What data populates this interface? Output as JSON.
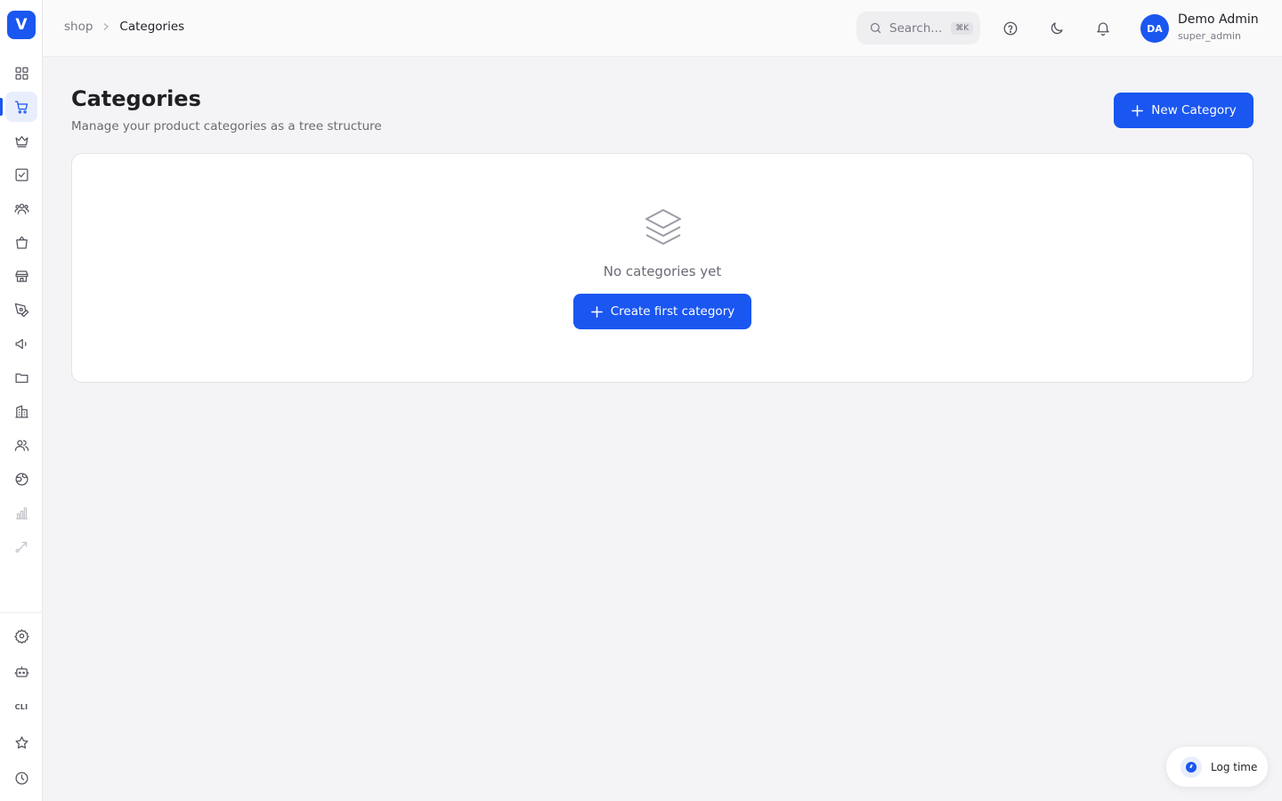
{
  "app": {
    "logo_letter": "V"
  },
  "breadcrumb": {
    "root": "shop",
    "current": "Categories"
  },
  "search": {
    "placeholder": "Search...",
    "shortcut": "⌘K"
  },
  "user": {
    "initials": "DA",
    "name": "Demo Admin",
    "role": "super_admin"
  },
  "page": {
    "title": "Categories",
    "subtitle": "Manage your product categories as a tree structure",
    "new_button": "New Category"
  },
  "empty_state": {
    "message": "No categories yet",
    "button": "Create first category"
  },
  "sidebar": {
    "items": [
      {
        "icon": "dashboard-icon"
      },
      {
        "icon": "shop-cart-icon",
        "active": true
      },
      {
        "icon": "crown-icon"
      },
      {
        "icon": "checkbox-icon"
      },
      {
        "icon": "people-icon"
      },
      {
        "icon": "shopping-bag-icon"
      },
      {
        "icon": "store-icon"
      },
      {
        "icon": "pen-tool-icon"
      },
      {
        "icon": "megaphone-icon"
      },
      {
        "icon": "folder-icon"
      },
      {
        "icon": "building-icon"
      },
      {
        "icon": "users-icon"
      },
      {
        "icon": "globe-icon"
      },
      {
        "icon": "bar-chart-icon"
      },
      {
        "icon": "route-icon"
      }
    ],
    "bottom": [
      {
        "icon": "settings-icon"
      },
      {
        "icon": "bot-icon"
      },
      {
        "icon": "cli-icon",
        "label": "CLI"
      },
      {
        "icon": "star-icon"
      },
      {
        "icon": "clock-icon"
      }
    ]
  },
  "log_time": {
    "label": "Log time"
  },
  "colors": {
    "accent": "#1a56f0",
    "background": "#f4f4f6"
  }
}
